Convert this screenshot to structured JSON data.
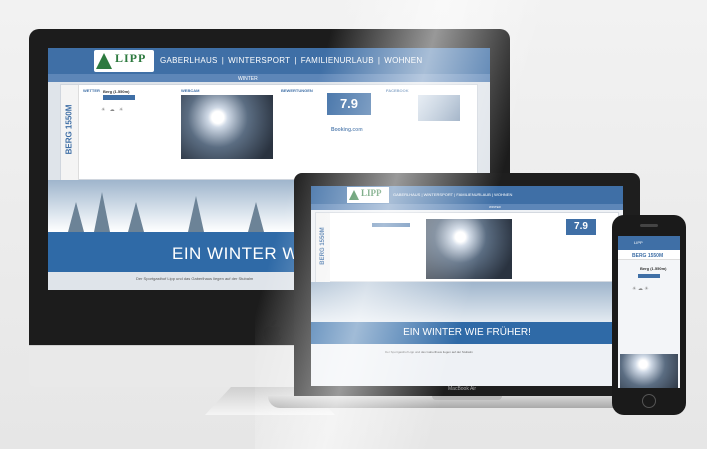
{
  "site": {
    "logo": "LIPP",
    "nav": [
      "GABERLHAUS",
      "|",
      "WINTERSPORT",
      "|",
      "FAMILIENURLAUB",
      "|",
      "WOHNEN"
    ],
    "subnav": "WINTER",
    "side_tab": "BERG 1550M",
    "weather_label": "WETTER",
    "weather_title": "Berg (1.550m)",
    "webcam_label": "WEBCAM",
    "rating_label": "BEWERTUNGEN",
    "rating_value": "7.9",
    "booking": "Booking.com",
    "facebook_label": "FACEBOOK",
    "banner": "EIN WINTER WIE",
    "body": "Der Sportgasthof Lipp und das Gaberlhaus liegen auf der Stubalm"
  },
  "laptop": {
    "label": "MacBook Air",
    "side_tab": "BERG 1550M",
    "rating_value": "7.9",
    "banner": "EIN WINTER WIE FRÜHER!"
  },
  "phone": {
    "tab": "BERG 1550M"
  }
}
